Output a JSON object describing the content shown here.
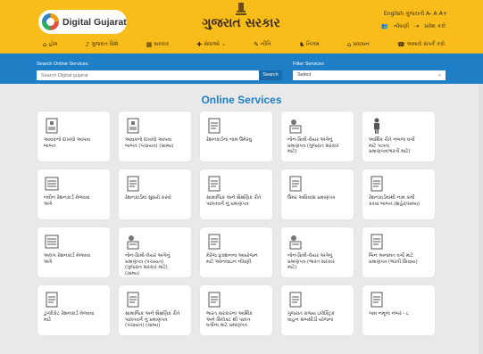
{
  "header": {
    "logo_text": "Digital Gujarat",
    "site_title": "ગુજરાત સરકાર",
    "top_links": "English  ગુજરાતી  A-  A  A+",
    "register_label": "નોંધણી",
    "login_label": "પ્રવેશ કરો"
  },
  "nav": [
    {
      "icon": "home-icon",
      "glyph": "⌂",
      "label": "હોમ"
    },
    {
      "icon": "bell-icon",
      "glyph": "♪",
      "label": "ગુજરાત વિશે"
    },
    {
      "icon": "building-icon",
      "glyph": "▦",
      "label": "સરકાર"
    },
    {
      "icon": "services-icon",
      "glyph": "✚",
      "label": "સેવાઓ ⌄"
    },
    {
      "icon": "policy-icon",
      "glyph": "✎",
      "label": "નીતિ"
    },
    {
      "icon": "people-icon",
      "glyph": "♞",
      "label": "નિગમ"
    },
    {
      "icon": "bell-icon",
      "glyph": "⌂",
      "label": "પ્રવાસન"
    },
    {
      "icon": "phone-icon",
      "glyph": "☎",
      "label": "અમારો સંપર્ક કરો"
    }
  ],
  "search": {
    "label": "Search Online Services",
    "placeholder": "Search Digital gujarat",
    "button_label": "Search"
  },
  "filter": {
    "label": "Filter Services",
    "selected": "Select"
  },
  "main": {
    "title": "Online Services",
    "cards": [
      {
        "icon": "document-icon",
        "label": "આવકનો દાખલો આપવા\nબાબત"
      },
      {
        "icon": "document-icon",
        "label": "આવકનો દાખલો આપવા\nબાબત (પંચાયત) (ગ્રામ્ય)"
      },
      {
        "icon": "ration-card-icon",
        "label": "રેશનકાર્ડના નામ ઉમેરવુ"
      },
      {
        "icon": "person-certificate-icon",
        "label": "નોન-ક્રિમી-લેયર અંગેનું\nપ્રમાણપત્ર (ગુજરાત સરકાર\nમાટે)"
      },
      {
        "icon": "person-standing-icon",
        "label": "આર્થિક રીતે નબળા વર્ગો\nમાટે પાત્રતા\nપ્રમાણપત્ર(ભરતી માટે)"
      },
      {
        "icon": "card-list-icon",
        "label": "નવીન રેશનકાર્ડ મેળવવા\nઅંગે"
      },
      {
        "icon": "edit-document-icon",
        "label": "રેશનકાર્ડમાં સુધારો કરવો"
      },
      {
        "icon": "id-certificate-icon",
        "label": "સામાજિક અને શૈક્ષણિક રીતે\nપછાતવર્ગ નું પ્રમાણપત્ર"
      },
      {
        "icon": "id-badge-icon",
        "label": "ઉંમર અધિવાસ પ્રમાણપત્ર"
      },
      {
        "icon": "remove-document-icon",
        "label": "રેશનકાર્ડમાંથી નામ કમી\nકરવા બાબત.(શહેર/ગ્રામ્ય)"
      },
      {
        "icon": "card-list-icon",
        "label": "અલગ રેશનકાર્ડ મેળવવા\nઅંગે"
      },
      {
        "icon": "person-certificate-icon",
        "label": "નોન-ક્રિમી-લેયર અંગેનું\nપ્રમાણપત્ર (પંચાયત)\n(ગુજરાત સરકાર માટે)\n(ગ્રામ્ય)"
      },
      {
        "icon": "party-icon",
        "label": "મેરેજ ફંક્શનના આયોજન\nમાટે ઓનલાઇન નોંધણી"
      },
      {
        "icon": "person-certificate-icon",
        "label": "નોન-ક્રિમી-લેયર અંગેનું\nપ્રમાણપત્ર (ભારત સરકાર\nમાટે)"
      },
      {
        "icon": "certificate-ribbon-icon",
        "label": "બિન અનામત વર્ગો માટે\nપ્રમાણપત્ર (ભરતી સિવાય)"
      },
      {
        "icon": "duplicate-card-icon",
        "label": "ડુપ્લીકેટ રેશનકાર્ડ મેળવવા\nમાટે"
      },
      {
        "icon": "id-certificate-icon",
        "label": "સામાજિક અને શૈક્ષણિક રીતે\nપછાતવર્ગ નું પ્રમાણપત્ર\n(પંચાયત) (ગ્રામ્ય)"
      },
      {
        "icon": "mobile-document-icon",
        "label": "ભારત સરકારના આર્થિક\nઅને સિલેક્ટ થી પછાત\nવર્ગોના માટે પ્રમાણપત્ર"
      },
      {
        "icon": "blank-document-icon",
        "label": "ગુજરાત રાજ્ય ઇલેક્ટ્રિક\nવાહન સબસીડી યોજના"
      },
      {
        "icon": "form-document-icon",
        "label": "ગામ નમૂના નંબર - ૮"
      }
    ]
  }
}
